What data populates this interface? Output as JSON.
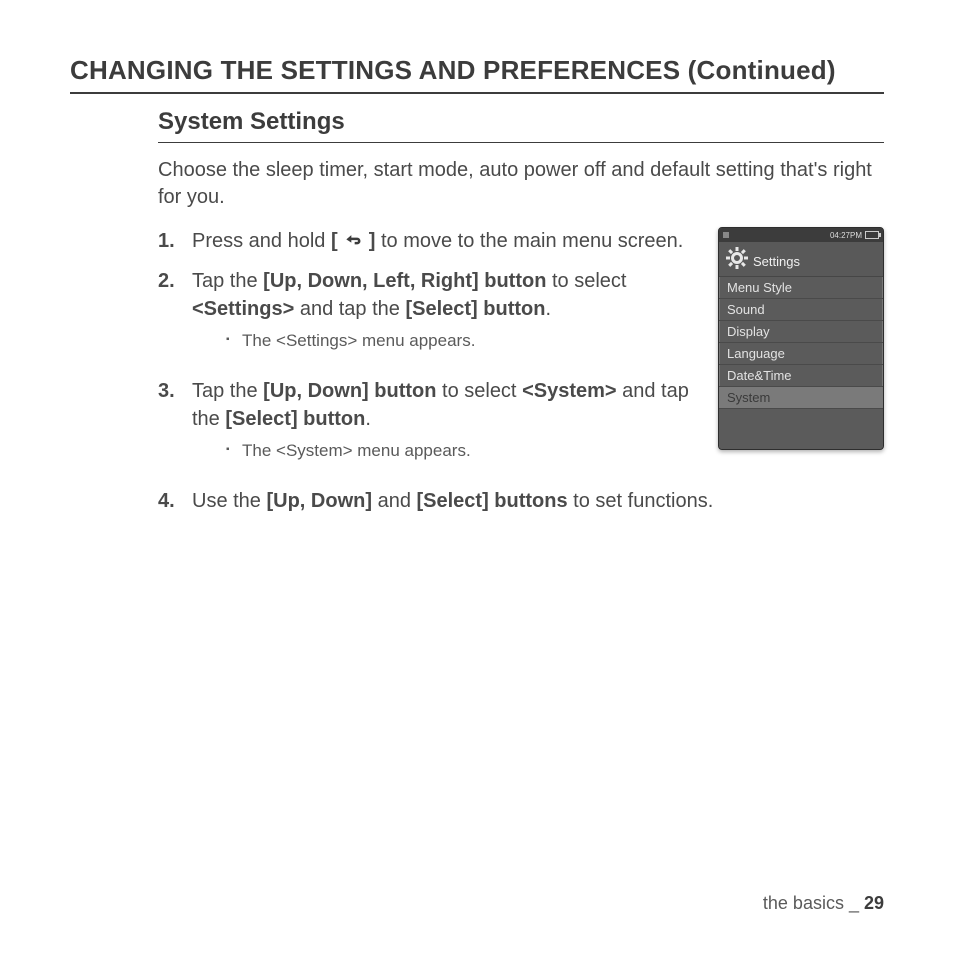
{
  "page_title": "CHANGING THE SETTINGS AND PREFERENCES (Continued)",
  "section_title": "System Settings",
  "intro": "Choose the sleep timer, start mode, auto power off and default setting that's right for you.",
  "steps": {
    "s1": {
      "num": "1.",
      "a": "Press and hold ",
      "b_open": "[ ",
      "b_close": " ]",
      "c": " to move to the main menu screen."
    },
    "s2": {
      "num": "2.",
      "a": "Tap the ",
      "b1": "[Up, Down, Left, Right] button",
      "c": " to select ",
      "b2": "<Settings>",
      "d": " and tap the ",
      "b3": "[Select] button",
      "e": ".",
      "sub": "The <Settings> menu appears."
    },
    "s3": {
      "num": "3.",
      "a": "Tap the ",
      "b1": "[Up, Down] button",
      "c": " to select ",
      "b2": "<System>",
      "d": " and tap the ",
      "b3": "[Select] button",
      "e": ".",
      "sub": "The <System> menu appears."
    },
    "s4": {
      "num": "4.",
      "a": "Use the ",
      "b1": "[Up, Down]",
      "c": " and ",
      "b2": "[Select] buttons",
      "d": " to set functions."
    }
  },
  "device": {
    "time": "04:27PM",
    "header": "Settings",
    "menu": [
      "Menu Style",
      "Sound",
      "Display",
      "Language",
      "Date&Time",
      "System"
    ],
    "selected_index": 5
  },
  "footer": {
    "section": "the basics",
    "sep": " _ ",
    "page": "29"
  }
}
